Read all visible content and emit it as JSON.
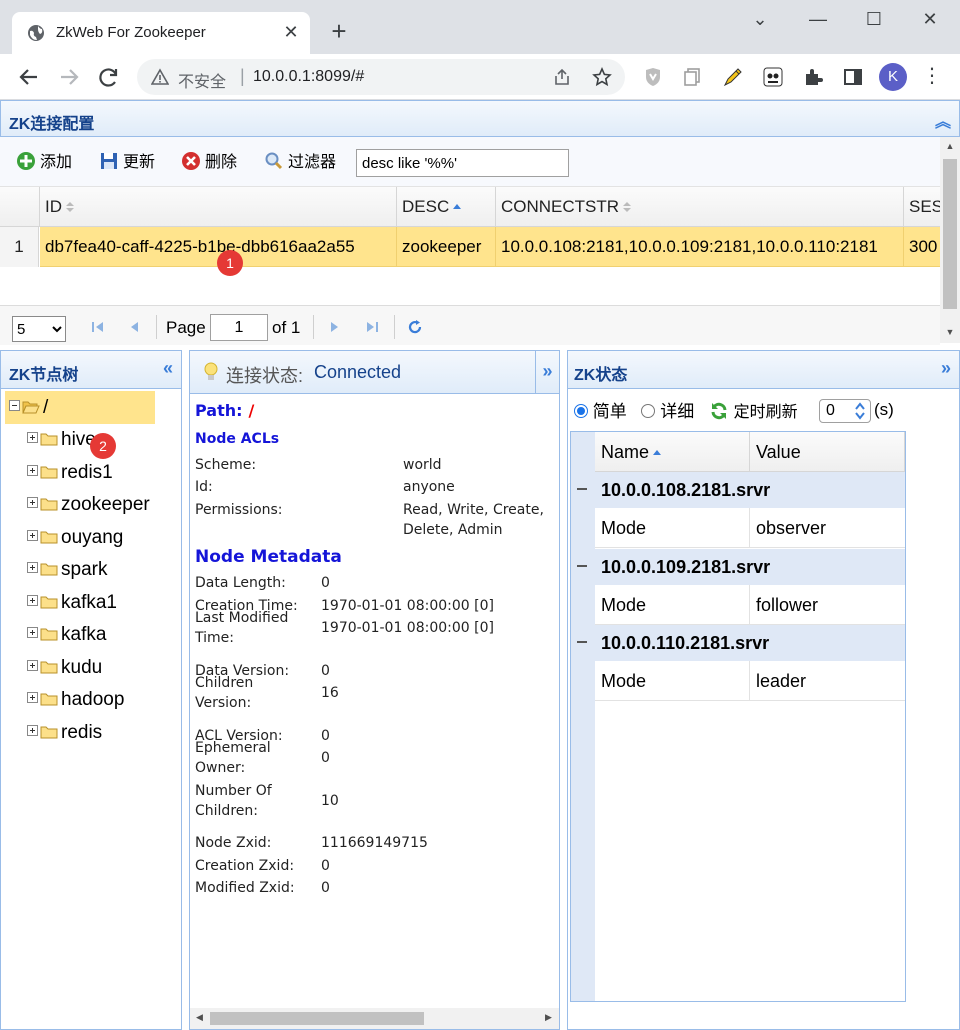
{
  "browser": {
    "tab_title": "ZkWeb For Zookeeper",
    "insecure_label": "不安全",
    "url": "10.0.0.1:8099/#",
    "profile_initial": "K"
  },
  "conn_panel": {
    "title": "ZK连接配置",
    "toolbar": {
      "add": "添加",
      "update": "更新",
      "delete": "删除",
      "filter": "过滤器",
      "filter_value": "desc like '%%'"
    },
    "columns": [
      "ID",
      "DESC",
      "CONNECTSTR",
      "SES"
    ],
    "rows": [
      {
        "num": "1",
        "id": "db7fea40-caff-4225-b1be-dbb616aa2a55",
        "desc": "zookeeper",
        "connectstr": "10.0.0.108:2181,10.0.0.109:2181,10.0.0.110:2181",
        "session": "300"
      }
    ],
    "pager": {
      "page_size": "5",
      "page_label": "Page",
      "page": "1",
      "of_label": "of 1"
    }
  },
  "tree_panel": {
    "title": "ZK节点树",
    "root": "/",
    "children": [
      "hive",
      "redis1",
      "zookeeper",
      "ouyang",
      "spark",
      "kafka1",
      "kafka",
      "kudu",
      "hadoop",
      "redis"
    ]
  },
  "node_panel": {
    "status_label": "连接状态:",
    "status_value": "Connected",
    "path_label": "Path:",
    "path_value": "/",
    "acl_title": "Node ACLs",
    "acls": [
      {
        "k": "Scheme:",
        "v": "world"
      },
      {
        "k": "Id:",
        "v": "anyone"
      },
      {
        "k": "Permissions:",
        "v": "Read, Write, Create,",
        "v2": "Delete, Admin"
      }
    ],
    "meta_title": "Node Metadata",
    "meta": [
      {
        "k": "Data Length:",
        "v": "0"
      },
      {
        "k": "Creation Time:",
        "v": "1970-01-01 08:00:00 [0]"
      },
      {
        "k": "Last Modified",
        "k2": "Time:",
        "v": "1970-01-01 08:00:00 [0]"
      },
      {
        "k": "Data Version:",
        "v": "0"
      },
      {
        "k": "Children",
        "k2": "Version:",
        "v": "16"
      },
      {
        "k": "ACL Version:",
        "v": "0"
      },
      {
        "k": "Ephemeral",
        "k2": "Owner:",
        "v": "0"
      },
      {
        "k": "Number Of",
        "k2": "Children:",
        "v": "10"
      },
      {
        "k": "Node Zxid:",
        "v": "111669149715"
      },
      {
        "k": "Creation Zxid:",
        "v": "0"
      },
      {
        "k": "Modified Zxid:",
        "v": "0"
      }
    ]
  },
  "status_panel": {
    "title": "ZK状态",
    "opt_simple": "简单",
    "opt_detail": "详细",
    "refresh_label": "定时刷新",
    "refresh_value": "0",
    "refresh_unit": "(s)",
    "col_name": "Name",
    "col_value": "Value",
    "groups": [
      {
        "server": "10.0.0.108.2181.srvr",
        "name": "Mode",
        "value": "observer"
      },
      {
        "server": "10.0.0.109.2181.srvr",
        "name": "Mode",
        "value": "follower"
      },
      {
        "server": "10.0.0.110.2181.srvr",
        "name": "Mode",
        "value": "leader"
      }
    ]
  },
  "badges": [
    "1",
    "2"
  ],
  "colors": {
    "header_text": "#15428b",
    "selected_row": "#ffe48d",
    "heading_blue": "#1515d8",
    "badge_red": "#e53935"
  }
}
